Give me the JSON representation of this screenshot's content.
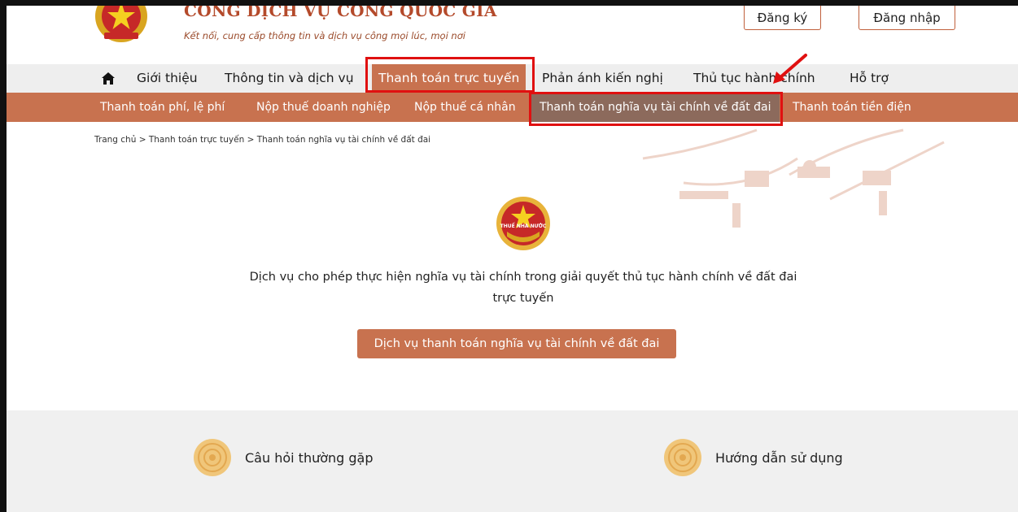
{
  "header": {
    "site_title": "CỔNG DỊCH VỤ CÔNG QUỐC GIA",
    "tagline": "Kết nối, cung cấp thông tin và dịch vụ công mọi lúc, mọi nơi",
    "register_label": "Đăng ký",
    "login_label": "Đăng nhập"
  },
  "main_nav": {
    "items": [
      {
        "label": "Giới thiệu"
      },
      {
        "label": "Thông tin và dịch vụ"
      },
      {
        "label": "Thanh toán trực tuyến",
        "active": true
      },
      {
        "label": "Phản ánh kiến nghị"
      },
      {
        "label": "Thủ tục hành chính"
      },
      {
        "label": "Hỗ trợ"
      }
    ]
  },
  "sub_nav": {
    "items": [
      {
        "label": "Thanh toán phí, lệ phí"
      },
      {
        "label": "Nộp thuế doanh nghiệp"
      },
      {
        "label": "Nộp thuế cá nhân"
      },
      {
        "label": "Thanh toán nghĩa vụ tài chính về đất đai",
        "active": true
      },
      {
        "label": "Thanh toán tiền điện"
      }
    ]
  },
  "breadcrumb": "Trang chủ > Thanh toán trực tuyến > Thanh toán nghĩa vụ tài chính về đất đai",
  "content": {
    "emblem_text": "THUẾ NHÀ NƯỚC",
    "description_line1": "Dịch  vụ cho phép thực hiện nghĩa vụ tài chính trong giải quyết thủ tục hành chính về đất đai",
    "description_line2": "trực tuyến",
    "cta_label": "Dịch vụ thanh toán nghĩa vụ tài chính về đất đai"
  },
  "footer": {
    "faq_label": "Câu hỏi thường gặp",
    "guide_label": "Hướng dẫn sử dụng"
  },
  "colors": {
    "accent": "#c8724f",
    "active_sub": "#8c6a5c",
    "highlight": "#e01010",
    "title": "#b44a2b"
  }
}
